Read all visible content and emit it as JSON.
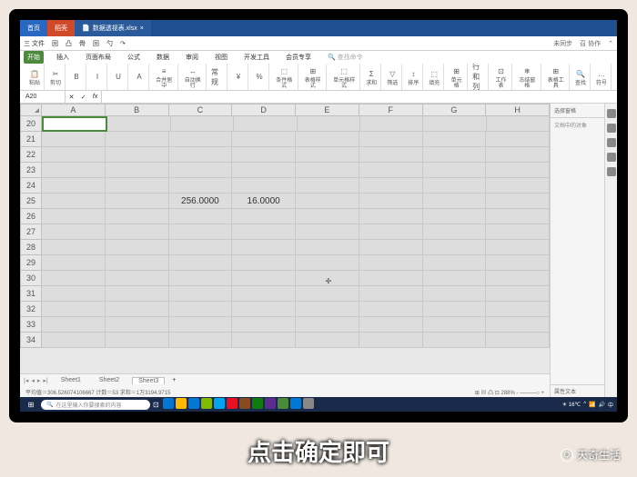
{
  "titlebar": {
    "tabs": [
      "首页",
      "稻壳"
    ],
    "doc": "数据透视表.xlsx"
  },
  "menubar": {
    "items": [
      "三 文件",
      "回",
      "凸",
      "骨",
      "回",
      "勺",
      "↷"
    ],
    "right_login": "未同步",
    "right_coop": "召 协作"
  },
  "ribbon": {
    "file": "文件",
    "tabs": [
      "开始",
      "插入",
      "页面布局",
      "公式",
      "数据",
      "审阅",
      "视图",
      "开发工具",
      "会员专享"
    ],
    "search": "查找命令"
  },
  "toolbar_groups": [
    {
      "icon": "📋",
      "label": "粘贴"
    },
    {
      "icon": "✂",
      "label": "剪切"
    },
    {
      "icon": "B",
      "label": ""
    },
    {
      "icon": "I",
      "label": ""
    },
    {
      "icon": "U",
      "label": ""
    },
    {
      "icon": "A",
      "label": ""
    },
    {
      "icon": "≡",
      "label": "合并居中"
    },
    {
      "icon": "↔",
      "label": "自动换行"
    },
    {
      "icon": "常规",
      "label": ""
    },
    {
      "icon": "¥",
      "label": ""
    },
    {
      "icon": "%",
      "label": ""
    },
    {
      "icon": "⬚",
      "label": "条件格式"
    },
    {
      "icon": "⊞",
      "label": "表格样式"
    },
    {
      "icon": "⬚",
      "label": "单元格样式"
    },
    {
      "icon": "Σ",
      "label": "求和"
    },
    {
      "icon": "▽",
      "label": "筛选"
    },
    {
      "icon": "↕",
      "label": "排序"
    },
    {
      "icon": "⬚",
      "label": "填充"
    },
    {
      "icon": "⊞",
      "label": "单元格"
    },
    {
      "icon": "行和列",
      "label": ""
    },
    {
      "icon": "⊡",
      "label": "工作表"
    },
    {
      "icon": "❄",
      "label": "冻结窗格"
    },
    {
      "icon": "⊞",
      "label": "表格工具"
    },
    {
      "icon": "🔍",
      "label": "查找"
    },
    {
      "icon": "…",
      "label": "符号"
    }
  ],
  "formula_bar": {
    "name_box": "A20",
    "fx": "fx"
  },
  "sheet": {
    "columns": [
      "A",
      "B",
      "C",
      "D",
      "E",
      "F",
      "G",
      "H"
    ],
    "rows": [
      20,
      21,
      22,
      23,
      24,
      25,
      26,
      27,
      28,
      29,
      30,
      31,
      32,
      33,
      34
    ],
    "active_cell": "A20",
    "cells": {
      "C25": "256.0000",
      "D25": "16.0000"
    },
    "cursor_pos": {
      "row": 30,
      "col": "E",
      "glyph": "✢"
    }
  },
  "side_panel": {
    "title": "选择窗格",
    "sub": "文档中的对象"
  },
  "side_bottom": {
    "title": "属性文本"
  },
  "sheet_tabs": {
    "tabs": [
      "Sheet1",
      "Sheet2",
      "Sheet3"
    ],
    "active": "Sheet3",
    "add": "+"
  },
  "statusbar": {
    "left": "平均值＝306.526074106667  计数＝53  求和＝1万3194.9715",
    "right_zoom": "288%"
  },
  "taskbar": {
    "search_placeholder": "在这里输入你要搜索的内容",
    "tray_temp": "16℃",
    "tray_time": "",
    "apps_colors": [
      "#0078d4",
      "#ffb900",
      "#0078d4",
      "#7fba00",
      "#00a4ef",
      "#e81123",
      "#8a4a20",
      "#107c10",
      "#5b2d8e",
      "#4a8a3a",
      "#0078d4",
      "#888"
    ]
  },
  "caption_text": "点击确定即可",
  "watermark_text": "天奇生活",
  "watermark_icon": "Q",
  "chart_data": null
}
